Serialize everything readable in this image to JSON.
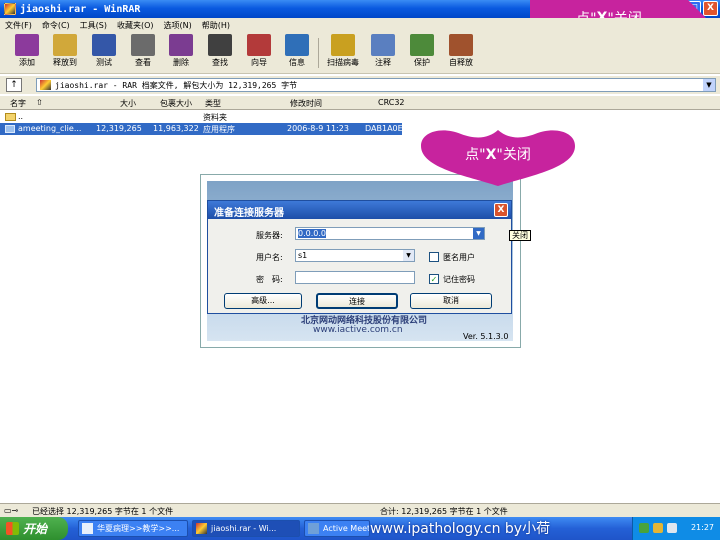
{
  "window": {
    "title": "jiaoshi.rar - WinRAR",
    "minimize": "_",
    "maximize": "□",
    "close": "X"
  },
  "callouts": {
    "top_prefix": "点\"",
    "top_key": "X",
    "top_suffix": "\"关闭",
    "heart_prefix": "点\"",
    "heart_key": "X",
    "heart_suffix": "\"关闭"
  },
  "menu": [
    "文件(F)",
    "命令(C)",
    "工具(S)",
    "收藏夹(O)",
    "选项(N)",
    "帮助(H)"
  ],
  "toolbar": [
    {
      "label": "添加",
      "icon": "add-icon",
      "color": "#8c3a9c"
    },
    {
      "label": "释放到",
      "icon": "extract-icon",
      "color": "#d1a83a"
    },
    {
      "label": "测试",
      "icon": "test-icon",
      "color": "#3457a8"
    },
    {
      "label": "查看",
      "icon": "view-icon",
      "color": "#6b6b6b"
    },
    {
      "label": "删除",
      "icon": "delete-icon",
      "color": "#7b3c91"
    },
    {
      "label": "查找",
      "icon": "find-icon",
      "color": "#404040"
    },
    {
      "label": "向导",
      "icon": "wizard-icon",
      "color": "#b33a3a"
    },
    {
      "label": "信息",
      "icon": "info-icon",
      "color": "#2f6fb8"
    },
    {
      "label": "扫描病毒",
      "icon": "virus-scan-icon",
      "color": "#c9a020"
    },
    {
      "label": "注释",
      "icon": "comment-icon",
      "color": "#5a7fc0"
    },
    {
      "label": "保护",
      "icon": "protect-icon",
      "color": "#4d8a3a"
    },
    {
      "label": "自释放",
      "icon": "sfx-icon",
      "color": "#a0522d"
    }
  ],
  "address": {
    "up_icon": "↑",
    "text": "jiaoshi.rar - RAR 档案文件, 解包大小为 12,319,265 字节",
    "dropdown": "▼"
  },
  "columns": {
    "name": "名字",
    "sort_icon": "⇧",
    "size": "大小",
    "packed": "包裹大小",
    "type": "类型",
    "modified": "修改时间",
    "crc": "CRC32"
  },
  "rows": [
    {
      "name": "..",
      "size": "",
      "packed": "",
      "type": "资料夹",
      "modified": "",
      "crc": ""
    },
    {
      "name": "ameeting_clie...",
      "size": "12,319,265",
      "packed": "11,963,322",
      "type": "应用程序",
      "modified": "2006-8-9 11:23",
      "crc": "DAB1A0E5"
    }
  ],
  "dialog": {
    "title": "准备连接服务器",
    "close": "X",
    "tooltip": "关闭",
    "server_label": "服务器:",
    "server_value": "0.0.0.0",
    "user_label": "用户名:",
    "user_value": "s1",
    "password_label": "密　码:",
    "password_value": "",
    "anonymous_label": "匿名用户",
    "anonymous_checked": false,
    "remember_label": "记住密码",
    "remember_checked": true,
    "check_mark": "✓",
    "dropdown": "▼",
    "advanced_button": "高级...",
    "connect_button": "连接",
    "cancel_button": "取消",
    "banner_text": "北京网动网络科技股份有限公司",
    "site": "www.iactive.com.cn",
    "version": "Ver. 5.1.3.0"
  },
  "status": {
    "left_icon": "▭⊸",
    "left": "已经选择 12,319,265 字节在 1 个文件",
    "right": "合计: 12,319,265 字节在 1 个文件"
  },
  "taskbar": {
    "start": "开始",
    "tasks": [
      "华夏病理>>教学>>...",
      "jiaoshi.rar - Wi...",
      "Active Meeting ..."
    ],
    "watermark": "www.ipathology.cn  by小荷",
    "clock": "21:27"
  }
}
